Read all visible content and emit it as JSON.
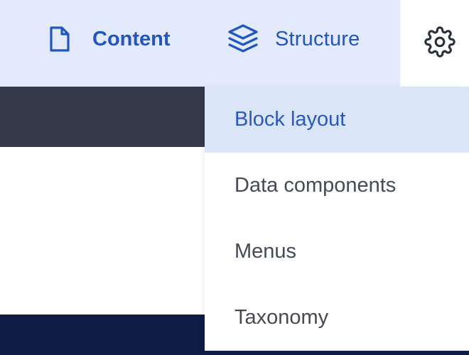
{
  "toolbar": {
    "items": [
      {
        "label": "Content",
        "icon": "document-icon"
      },
      {
        "label": "Structure",
        "icon": "layers-icon"
      }
    ],
    "settings_icon": "gear-icon"
  },
  "dropdown": {
    "items": [
      {
        "label": "Block layout",
        "active": true
      },
      {
        "label": "Data components",
        "active": false
      },
      {
        "label": "Menus",
        "active": false
      },
      {
        "label": "Taxonomy",
        "active": false
      }
    ]
  },
  "colors": {
    "toolbar_bg": "#e3eafb",
    "accent": "#2155c7",
    "active_item_bg": "#dbe5f8",
    "dark_band": "#343a4a",
    "footer_navy": "#0f1c45",
    "menu_text": "#454a55"
  }
}
